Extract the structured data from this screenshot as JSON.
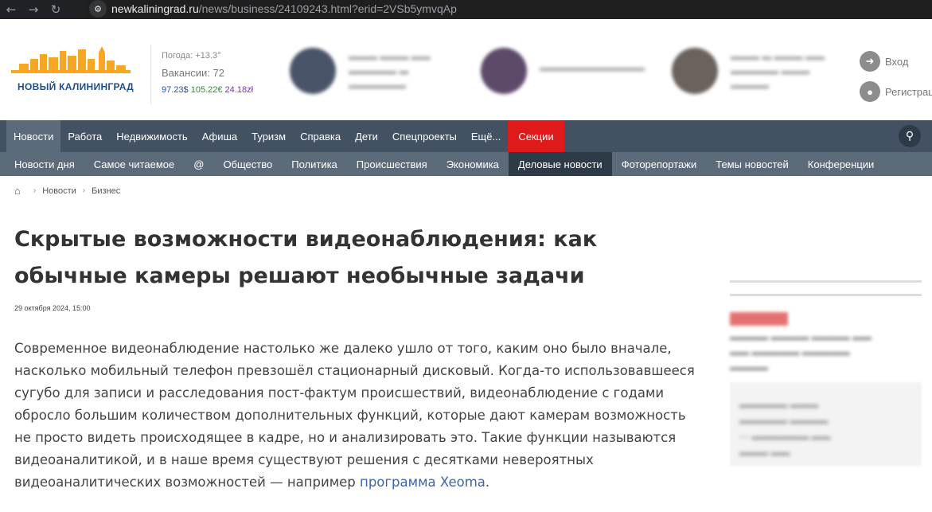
{
  "browser": {
    "url_host": "newkaliningrad.ru",
    "url_path": "/news/business/24109243.html?erid=2VSb5ymvqAp"
  },
  "header": {
    "logo_text": "НОВЫЙ КАЛИНИНГРАД",
    "weather": "Погода: +13.3°",
    "jobs": "Вакансии: 72",
    "rate_usd": "97.23$",
    "rate_eur": "105.22€",
    "rate_pln": "24.18zł",
    "login": "Вход",
    "register": "Регистрация"
  },
  "main_nav": [
    "Новости",
    "Работа",
    "Недвижимость",
    "Афиша",
    "Туризм",
    "Справка",
    "Дети",
    "Спецпроекты",
    "Ещё...",
    "Секции"
  ],
  "sub_nav": [
    "Новости дня",
    "Самое читаемое",
    "@",
    "Общество",
    "Политика",
    "Происшествия",
    "Экономика",
    "Деловые новости",
    "Фоторепортажи",
    "Темы новостей",
    "Конференции"
  ],
  "breadcrumb": [
    "Новости",
    "Бизнес"
  ],
  "article": {
    "title": "Скрытые возможности видеонаблюдения: как обычные камеры решают необычные задачи",
    "date": "29 октября 2024, 15:00",
    "body": "Современное видеонаблюдение настолько же далеко ушло от того, каким оно было вначале, насколько мобильный телефон превзошёл стационарный дисковый. Когда-то использовавшееся сугубо для записи и расследования пост-фактум происшествий, видеонаблюдение с годами обросло большим количеством дополнительных функций, которые дают камерам возможность не просто видеть происходящее в кадре, но и анализировать это. Такие функции называются видеоаналитикой, и в наше время существуют решения с десятками невероятных видеоаналитических возможностей — например ",
    "link_text": "программа Xeoma",
    "after_link": "."
  },
  "colors": {
    "nav_bg": "#435262",
    "subnav_bg": "#5c6b7a",
    "accent_red": "#e01a1a",
    "link": "#3d64a6"
  }
}
